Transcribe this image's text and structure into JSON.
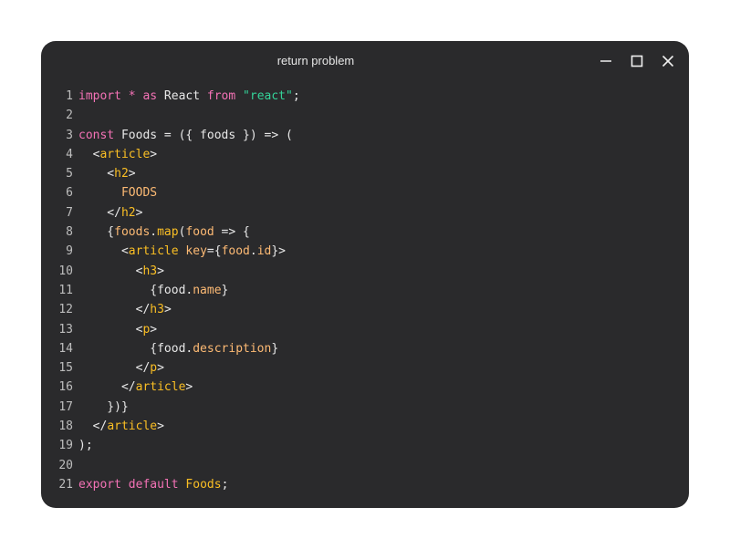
{
  "window": {
    "title": "return problem"
  },
  "code": {
    "lines": [
      [
        {
          "t": "import",
          "c": "kw"
        },
        {
          "t": " ",
          "c": "pl"
        },
        {
          "t": "*",
          "c": "kw"
        },
        {
          "t": " ",
          "c": "pl"
        },
        {
          "t": "as",
          "c": "kw"
        },
        {
          "t": " React ",
          "c": "pl"
        },
        {
          "t": "from",
          "c": "kw"
        },
        {
          "t": " ",
          "c": "pl"
        },
        {
          "t": "\"react\"",
          "c": "str"
        },
        {
          "t": ";",
          "c": "pl"
        }
      ],
      [],
      [
        {
          "t": "const",
          "c": "kw"
        },
        {
          "t": " Foods = ({ foods }) => (",
          "c": "pl"
        }
      ],
      [
        {
          "t": "  <",
          "c": "pl"
        },
        {
          "t": "article",
          "c": "tag"
        },
        {
          "t": ">",
          "c": "pl"
        }
      ],
      [
        {
          "t": "    <",
          "c": "pl"
        },
        {
          "t": "h2",
          "c": "tag"
        },
        {
          "t": ">",
          "c": "pl"
        }
      ],
      [
        {
          "t": "      FOODS",
          "c": "txt"
        }
      ],
      [
        {
          "t": "    </",
          "c": "pl"
        },
        {
          "t": "h2",
          "c": "tag"
        },
        {
          "t": ">",
          "c": "pl"
        }
      ],
      [
        {
          "t": "    {",
          "c": "pl"
        },
        {
          "t": "foods",
          "c": "prop"
        },
        {
          "t": ".",
          "c": "pl"
        },
        {
          "t": "map",
          "c": "fn"
        },
        {
          "t": "(",
          "c": "pl"
        },
        {
          "t": "food",
          "c": "prop"
        },
        {
          "t": " => {",
          "c": "pl"
        }
      ],
      [
        {
          "t": "      <",
          "c": "pl"
        },
        {
          "t": "article",
          "c": "tag"
        },
        {
          "t": " ",
          "c": "pl"
        },
        {
          "t": "key",
          "c": "prop"
        },
        {
          "t": "={",
          "c": "pl"
        },
        {
          "t": "food",
          "c": "prop"
        },
        {
          "t": ".",
          "c": "pl"
        },
        {
          "t": "id",
          "c": "prop"
        },
        {
          "t": "}>",
          "c": "pl"
        }
      ],
      [
        {
          "t": "        <",
          "c": "pl"
        },
        {
          "t": "h3",
          "c": "tag"
        },
        {
          "t": ">",
          "c": "pl"
        }
      ],
      [
        {
          "t": "          {food.",
          "c": "pl"
        },
        {
          "t": "name",
          "c": "prop"
        },
        {
          "t": "}",
          "c": "pl"
        }
      ],
      [
        {
          "t": "        </",
          "c": "pl"
        },
        {
          "t": "h3",
          "c": "tag"
        },
        {
          "t": ">",
          "c": "pl"
        }
      ],
      [
        {
          "t": "        <",
          "c": "pl"
        },
        {
          "t": "p",
          "c": "tag"
        },
        {
          "t": ">",
          "c": "pl"
        }
      ],
      [
        {
          "t": "          {food.",
          "c": "pl"
        },
        {
          "t": "description",
          "c": "prop"
        },
        {
          "t": "}",
          "c": "pl"
        }
      ],
      [
        {
          "t": "        </",
          "c": "pl"
        },
        {
          "t": "p",
          "c": "tag"
        },
        {
          "t": ">",
          "c": "pl"
        }
      ],
      [
        {
          "t": "      </",
          "c": "pl"
        },
        {
          "t": "article",
          "c": "tag"
        },
        {
          "t": ">",
          "c": "pl"
        }
      ],
      [
        {
          "t": "    })}",
          "c": "pl"
        }
      ],
      [
        {
          "t": "  </",
          "c": "pl"
        },
        {
          "t": "article",
          "c": "tag"
        },
        {
          "t": ">",
          "c": "pl"
        }
      ],
      [
        {
          "t": ");",
          "c": "pl"
        }
      ],
      [],
      [
        {
          "t": "export",
          "c": "kw"
        },
        {
          "t": " ",
          "c": "pl"
        },
        {
          "t": "default",
          "c": "kw"
        },
        {
          "t": " ",
          "c": "pl"
        },
        {
          "t": "Foods",
          "c": "fn"
        },
        {
          "t": ";",
          "c": "pl"
        }
      ]
    ]
  },
  "icons": {
    "minimize": "minimize-icon",
    "maximize": "maximize-icon",
    "close": "close-icon"
  },
  "colors": {
    "background": "#2a2a2c",
    "keyword": "#f472b6",
    "string": "#34d399",
    "tag": "#fbbf24",
    "property": "#fdba74"
  }
}
